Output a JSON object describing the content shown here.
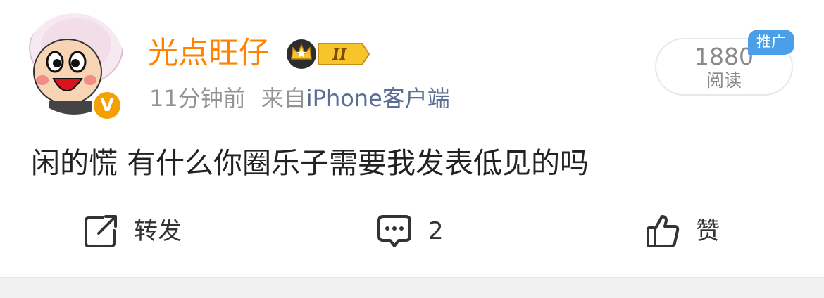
{
  "user": {
    "name": "光点旺仔",
    "level_badge": "II",
    "verified_badge": "V"
  },
  "meta": {
    "time": "11分钟前",
    "source_prefix": "来自",
    "source": "iPhone客户端"
  },
  "reads": {
    "count": "1880",
    "label": "阅读",
    "promo_tag": "推广"
  },
  "post": {
    "text": "闲的慌 有什么你圈乐子需要我发表低见的吗"
  },
  "actions": {
    "repost_label": "转发",
    "comment_count": "2",
    "like_label": "赞"
  },
  "colors": {
    "username": "#ff8200",
    "source": "#5b6f96",
    "promo": "#4a9fe8",
    "verified": "#f5a000"
  },
  "icons": [
    "avatar",
    "verified-icon",
    "level-crown-icon",
    "repost-icon",
    "comment-icon",
    "like-icon"
  ]
}
